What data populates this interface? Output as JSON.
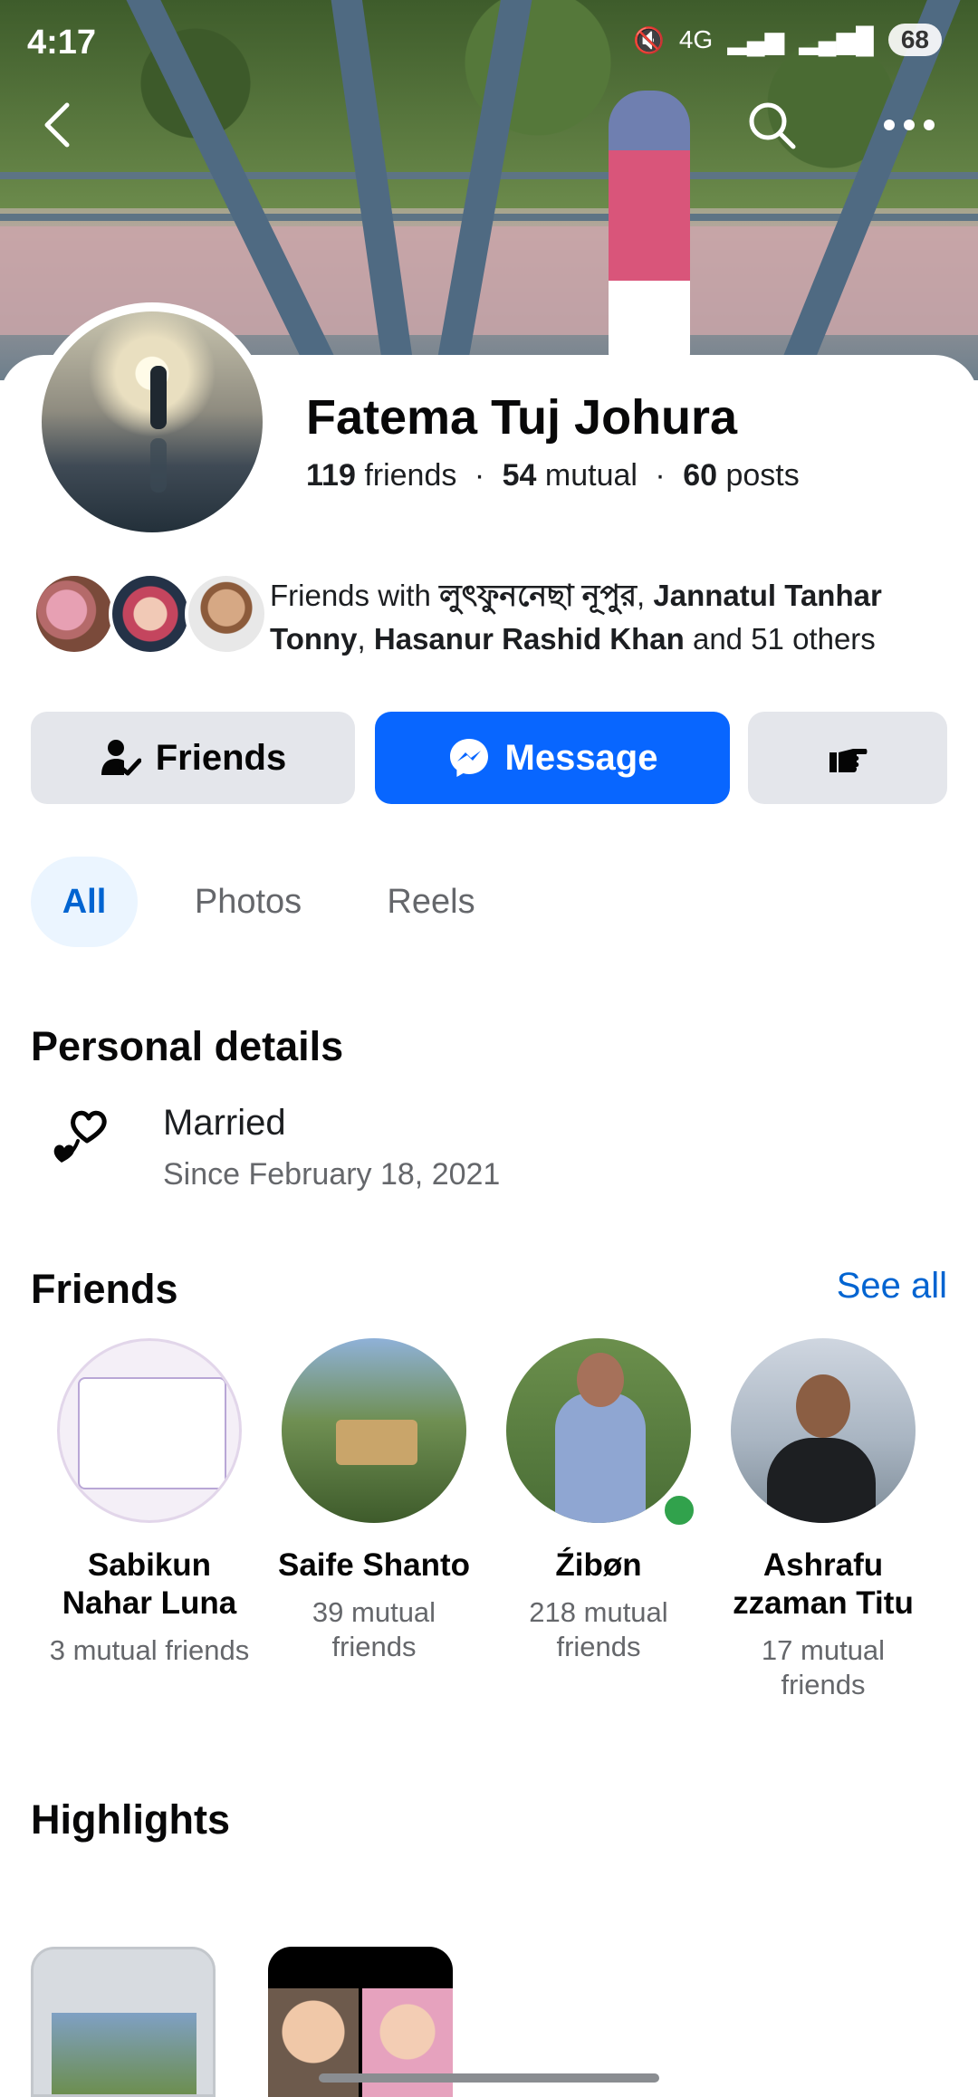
{
  "status_bar": {
    "time": "4:17",
    "network": "4G",
    "battery": "68"
  },
  "profile": {
    "name": "Fatema Tuj Johura",
    "friends_count": "119",
    "friends_label": "friends",
    "mutual_count": "54",
    "mutual_label": "mutual",
    "posts_count": "60",
    "posts_label": "posts",
    "separator": "·"
  },
  "mutual_friends": {
    "prefix": "Friends with ",
    "name1": "লুৎফুননেছা নূপুর",
    "comma1": ", ",
    "name2": "Jannatul Tanhar Tonny",
    "comma2": ", ",
    "name3": "Hasanur Rashid Khan",
    "suffix": " and 51 others"
  },
  "actions": {
    "friends_label": "Friends",
    "message_label": "Message"
  },
  "tabs": [
    {
      "label": "All"
    },
    {
      "label": "Photos"
    },
    {
      "label": "Reels"
    }
  ],
  "personal_details": {
    "title": "Personal details",
    "relationship": "Married",
    "since": "Since February 18, 2021"
  },
  "friends_section": {
    "title": "Friends",
    "see_all": "See all",
    "items": [
      {
        "name": "Sabikun Nahar Luna",
        "mutual": "3 mutual friends"
      },
      {
        "name": "Saife Shanto",
        "mutual": "39 mutual friends"
      },
      {
        "name": "Źibøn",
        "mutual": "218 mutual friends"
      },
      {
        "name": "Ashrafu zzaman Titu",
        "mutual": "17 mutual friends"
      }
    ]
  },
  "highlights": {
    "title": "Highlights"
  },
  "colors": {
    "brand_blue": "#0866ff",
    "link_blue": "#0064d1",
    "online_green": "#31a24c"
  }
}
